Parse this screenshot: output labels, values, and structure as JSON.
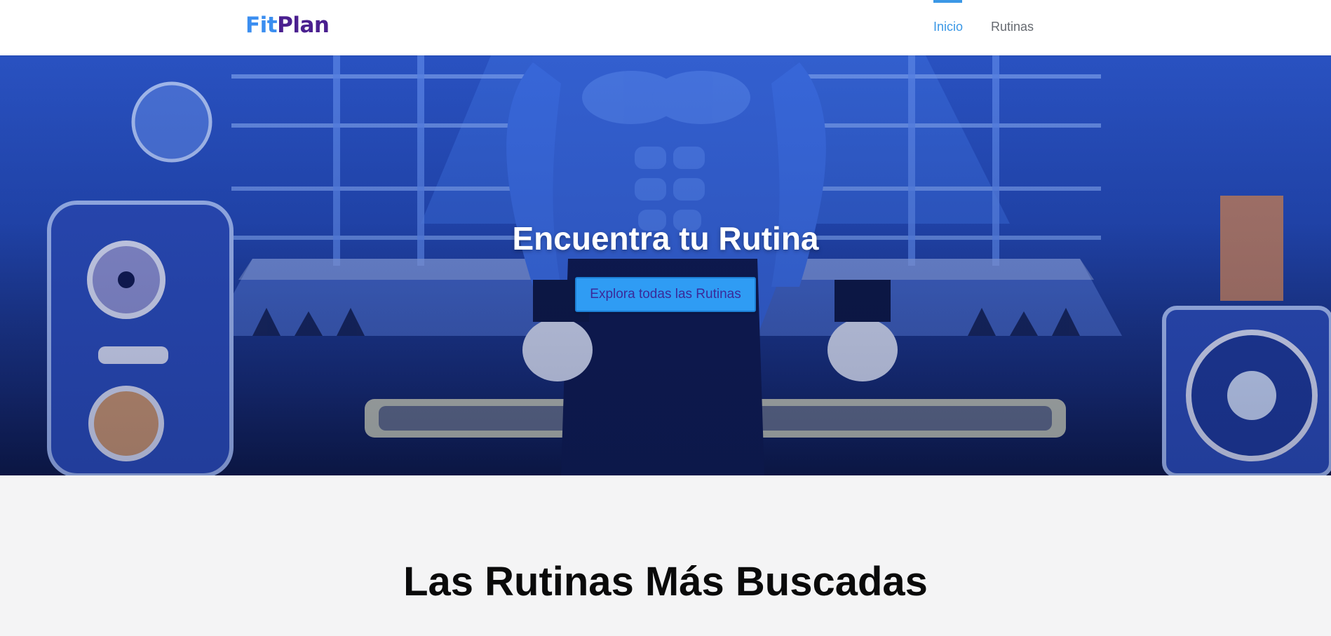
{
  "brand": {
    "part1": "Fit",
    "part2": "Plan"
  },
  "nav": {
    "items": [
      {
        "label": "Inicio",
        "active": true
      },
      {
        "label": "Rutinas",
        "active": false
      }
    ]
  },
  "hero": {
    "title": "Encuentra tu Rutina",
    "button_label": "Explora todas las Rutinas"
  },
  "section": {
    "title": "Las Rutinas Más Buscadas"
  },
  "colors": {
    "brand_fit": "#3b8ef0",
    "brand_plan": "#4a1f8f",
    "accent": "#3b98e6",
    "hero_blue": "#2349b5",
    "button_bg": "#2f9cf4"
  }
}
